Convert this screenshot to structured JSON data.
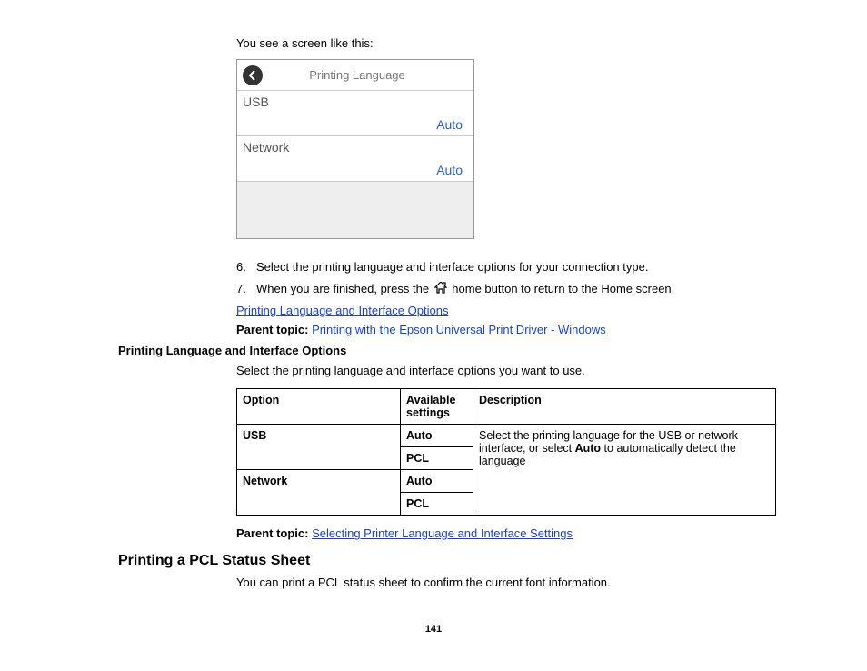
{
  "intro": "You see a screen like this:",
  "screenshot": {
    "title": "Printing Language",
    "rows": [
      {
        "label": "USB",
        "value": "Auto"
      },
      {
        "label": "Network",
        "value": "Auto"
      }
    ]
  },
  "steps": [
    {
      "num": "6.",
      "text_before": "Select the printing language and interface options for your connection type.",
      "has_icon": false
    },
    {
      "num": "7.",
      "text_before": "When you are finished, press the ",
      "text_after": " home button to return to the Home screen.",
      "has_icon": true
    }
  ],
  "link1": "Printing Language and Interface Options",
  "parent_topic_label": "Parent topic:",
  "parent_topic1_link": "Printing with the Epson Universal Print Driver - Windows",
  "section_heading": "Printing Language and Interface Options",
  "section_body": "Select the printing language and interface options you want to use.",
  "table": {
    "headers": {
      "option": "Option",
      "available": "Available settings",
      "description": "Description"
    },
    "group1": {
      "option": "USB",
      "s1": "Auto",
      "s2": "PCL"
    },
    "group2": {
      "option": "Network",
      "s1": "Auto",
      "s2": "PCL"
    },
    "desc_p1": "Select the printing language for the USB or network interface, or select ",
    "desc_bold": "Auto",
    "desc_p2": " to automatically detect the language"
  },
  "parent_topic2_link": "Selecting Printer Language and Interface Settings",
  "major_heading": "Printing a PCL Status Sheet",
  "major_body": "You can print a PCL status sheet to confirm the current font information.",
  "page_number": "141"
}
